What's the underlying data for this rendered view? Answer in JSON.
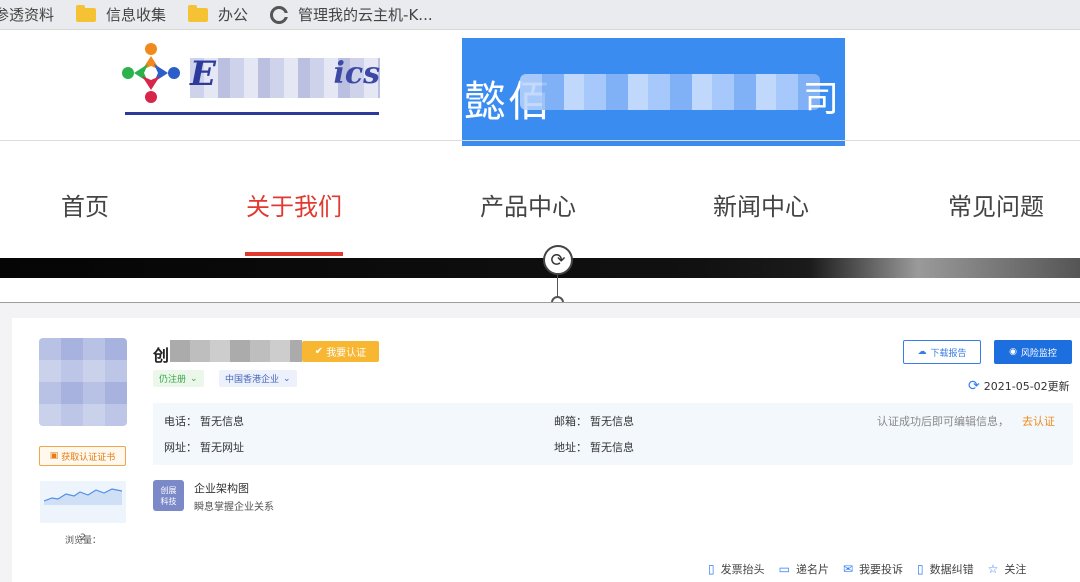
{
  "bookmarks": [
    {
      "label": "参透资料",
      "icon": "none"
    },
    {
      "label": "信息收集",
      "icon": "folder-icon"
    },
    {
      "label": "办公",
      "icon": "folder-icon"
    },
    {
      "label": "管理我的云主机-K...",
      "icon": "g-icon"
    }
  ],
  "header": {
    "logo_text_start": "E",
    "logo_text_end": "ics",
    "brand_first_char": "懿",
    "brand_second_char": "佰",
    "brand_last_char": "司"
  },
  "nav": {
    "items": [
      "首页",
      "关于我们",
      "产品中心",
      "新闻中心",
      "常见问题"
    ],
    "active_index": 1
  },
  "company": {
    "name_visible": "创",
    "verify_badge": "我要认证",
    "status_tag": "仍注册",
    "region_tag": "中国香港企业",
    "download_report": "下载报告",
    "risk_monitor": "风险监控",
    "updated": "2021-05-02更新",
    "phone_label": "电话：",
    "phone_value": "暂无信息",
    "email_label": "邮箱：",
    "email_value": "暂无信息",
    "website_label": "网址：",
    "website_value": "暂无网址",
    "address_label": "地址：",
    "address_value": "暂无信息",
    "cert_note": "认证成功后即可编辑信息，",
    "cert_link": "去认证",
    "get_cert": "获取认证证书",
    "views_label": "浏览量：",
    "views_count": "2",
    "org_icon_line1": "创展",
    "org_icon_line2": "科技",
    "org_title": "企业架构图",
    "org_sub": "瞬息掌握企业关系"
  },
  "actions": [
    {
      "label": "发票抬头",
      "icon": "invoice-icon"
    },
    {
      "label": "递名片",
      "icon": "card-icon"
    },
    {
      "label": "我要投诉",
      "icon": "mail-icon"
    },
    {
      "label": "数据纠错",
      "icon": "edit-doc-icon"
    },
    {
      "label": "关注",
      "icon": "star-icon"
    }
  ],
  "colors": {
    "accent_red": "#e03a30",
    "brand_blue": "#3b8cf1",
    "primary_blue": "#1d6fe0",
    "badge_orange": "#f8b733"
  }
}
